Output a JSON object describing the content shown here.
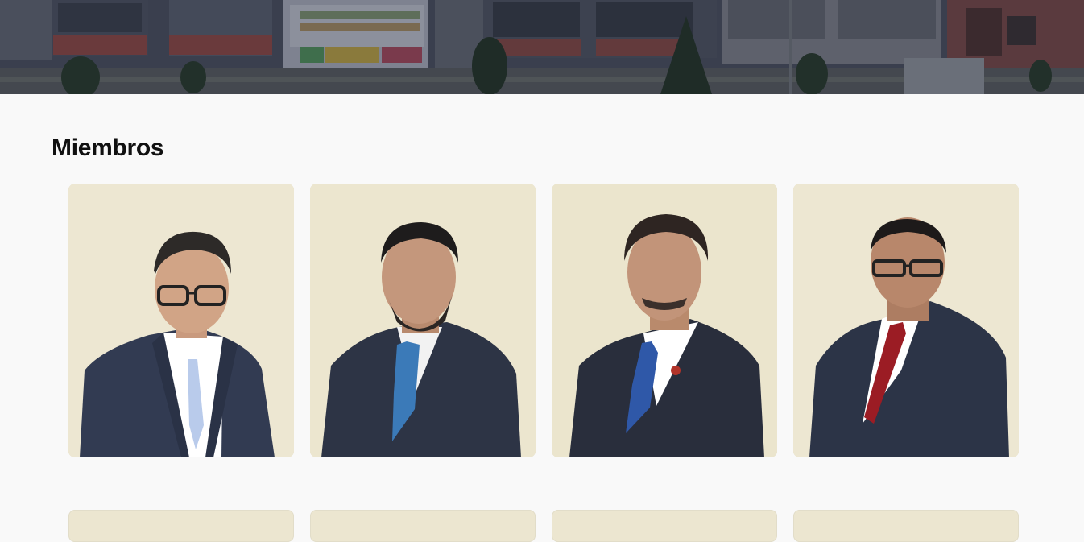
{
  "hero": {
    "image": "campus-building-photo"
  },
  "members_section": {
    "title": "Miembros",
    "members": [
      {
        "photo": "member-photo-1",
        "tie": "#b9cbeb",
        "shirt": "#ffffff"
      },
      {
        "photo": "member-photo-2",
        "tie": "#3b7ab8",
        "shirt": "#f2f2f2"
      },
      {
        "photo": "member-photo-3",
        "tie": "#2f58a8",
        "shirt": "#ffffff"
      },
      {
        "photo": "member-photo-4",
        "tie": "#9b1c24",
        "shirt": "#ffffff"
      }
    ],
    "next_row": [
      {
        "photo": "member-photo-5"
      },
      {
        "photo": "member-photo-6"
      },
      {
        "photo": "member-photo-7"
      },
      {
        "photo": "member-photo-8"
      }
    ]
  },
  "colors": {
    "background": "#f9f9f9",
    "photo_bg": "#ece6d0",
    "suit": "#2e3648",
    "title": "#111111"
  }
}
